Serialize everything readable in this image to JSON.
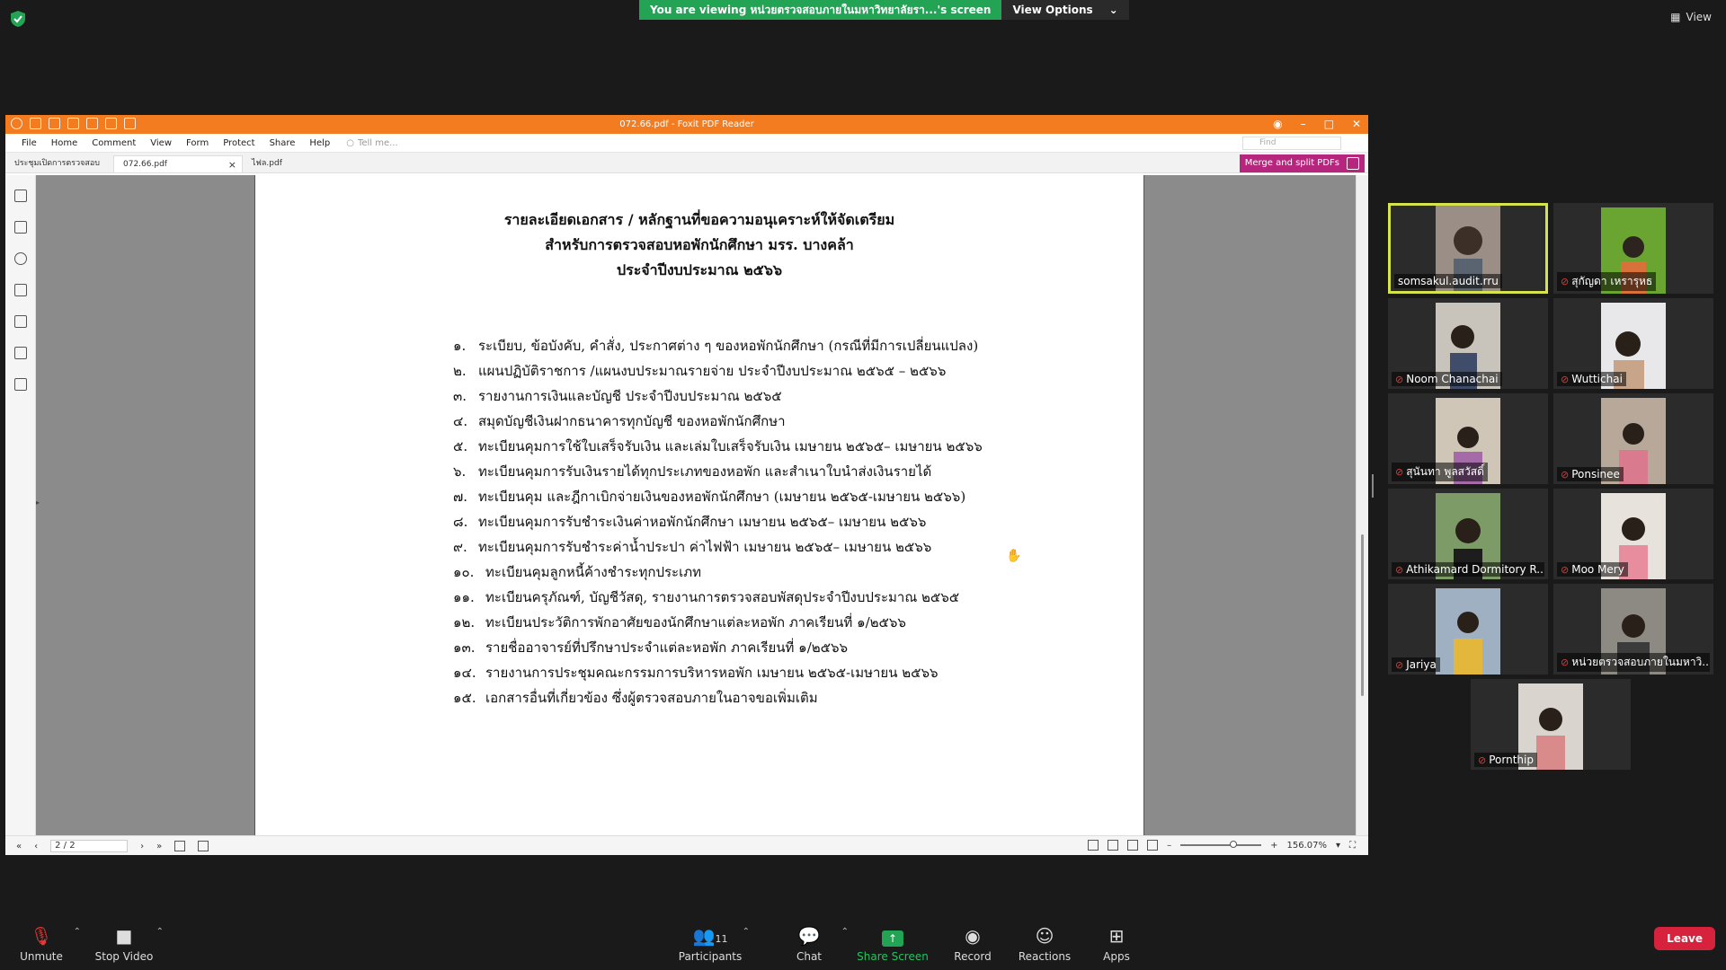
{
  "zoom": {
    "banner_text": "You are viewing หน่วยตรวจสอบภายในมหาวิทยาลัยรา...'s screen",
    "view_options_label": "View Options",
    "view_label": "View",
    "colors": {
      "banner_green": "#23a455",
      "leave_red": "#d6223d",
      "active_speaker": "#d6e34b"
    }
  },
  "foxit": {
    "window_title": "072.66.pdf - Foxit PDF Reader",
    "menu": [
      "File",
      "Home",
      "Comment",
      "View",
      "Form",
      "Protect",
      "Share",
      "Help"
    ],
    "tell_me_placeholder": "Tell me...",
    "find_placeholder": "Find",
    "tabs": [
      {
        "label": "ประชุมเปิดการตรวจสอบ"
      },
      {
        "label": "072.66.pdf"
      },
      {
        "label": "ไฟล.pdf"
      }
    ],
    "merge_label": "Merge and split PDFs",
    "page_indicator": "2 / 2",
    "zoom_level": "156.07%",
    "accent_color": "#f47c20"
  },
  "document": {
    "heading": [
      "รายละเอียดเอกสาร / หลักฐานที่ขอความอนุเคราะห์ให้จัดเตรียม",
      "สำหรับการตรวจสอบหอพักนักศึกษา มรร. บางคล้า",
      "ประจำปีงบประมาณ ๒๕๖๖"
    ],
    "items": [
      {
        "num": "๑.",
        "text": "ระเบียบ, ข้อบังคับ, คำสั่ง, ประกาศต่าง ๆ ของหอพักนักศึกษา (กรณีที่มีการเปลี่ยนแปลง)"
      },
      {
        "num": "๒.",
        "text": "แผนปฏิบัติราชการ /แผนงบประมาณรายจ่าย ประจำปีงบประมาณ ๒๕๖๕ – ๒๕๖๖"
      },
      {
        "num": "๓.",
        "text": "รายงานการเงินและบัญชี ประจำปีงบประมาณ ๒๕๖๕"
      },
      {
        "num": "๔.",
        "text": "สมุดบัญชีเงินฝากธนาคารทุกบัญชี ของหอพักนักศึกษา"
      },
      {
        "num": "๕.",
        "text": "ทะเบียนคุมการใช้ใบเสร็จรับเงิน และเล่มใบเสร็จรับเงิน เมษายน ๒๕๖๕– เมษายน ๒๕๖๖"
      },
      {
        "num": "๖.",
        "text": "ทะเบียนคุมการรับเงินรายได้ทุกประเภทของหอพัก และสำเนาใบนำส่งเงินรายได้"
      },
      {
        "num": "๗.",
        "text": "ทะเบียนคุม และฎีกาเบิกจ่ายเงินของหอพักนักศึกษา (เมษายน ๒๕๖๕-เมษายน ๒๕๖๖)"
      },
      {
        "num": "๘.",
        "text": "ทะเบียนคุมการรับชำระเงินค่าหอพักนักศึกษา เมษายน ๒๕๖๕– เมษายน ๒๕๖๖"
      },
      {
        "num": "๙.",
        "text": "ทะเบียนคุมการรับชำระค่าน้ำประปา ค่าไฟฟ้า เมษายน ๒๕๖๕– เมษายน ๒๕๖๖"
      },
      {
        "num": "๑๐.",
        "text": "ทะเบียนคุมลูกหนี้ค้างชำระทุกประเภท"
      },
      {
        "num": "๑๑.",
        "text": "ทะเบียนครุภัณฑ์, บัญชีวัสดุ, รายงานการตรวจสอบพัสดุประจำปีงบประมาณ ๒๕๖๕"
      },
      {
        "num": "๑๒.",
        "text": "ทะเบียนประวัติการพักอาศัยของนักศึกษาแต่ละหอพัก ภาคเรียนที่ ๑/๒๕๖๖"
      },
      {
        "num": "๑๓.",
        "text": "รายชื่ออาจารย์ที่ปรึกษาประจำแต่ละหอพัก ภาคเรียนที่ ๑/๒๕๖๖"
      },
      {
        "num": "๑๔.",
        "text": "รายงานการประชุมคณะกรรมการบริหารหอพัก เมษายน ๒๕๖๕-เมษายน ๒๕๖๖"
      },
      {
        "num": "๑๕.",
        "text": "เอกสารอื่นที่เกี่ยวข้อง ซึ่งผู้ตรวจสอบภายในอาจขอเพิ่มเติม"
      }
    ]
  },
  "participants_tiles": [
    {
      "name": "somsakul.audit.rru",
      "muted": false,
      "active": true
    },
    {
      "name": "สุกัญดา เหรารุหธ",
      "muted": true,
      "active": false
    },
    {
      "name": "Noom Chanachai",
      "muted": true,
      "active": false
    },
    {
      "name": "Wuttichai",
      "muted": true,
      "active": false
    },
    {
      "name": "สุนันทา พูลสวัสดิ์",
      "muted": true,
      "active": false
    },
    {
      "name": "Ponsinee",
      "muted": true,
      "active": false
    },
    {
      "name": "Athikamard Dormitory R...",
      "muted": true,
      "active": false
    },
    {
      "name": "Moo Mery",
      "muted": true,
      "active": false
    },
    {
      "name": "Jariya",
      "muted": true,
      "active": false
    },
    {
      "name": "หน่วยตรวจสอบภายในมหาวิ...",
      "muted": true,
      "active": false
    },
    {
      "name": "Pornthip",
      "muted": true,
      "active": false
    }
  ],
  "toolbar": {
    "unmute": "Unmute",
    "stop_video": "Stop Video",
    "participants": "Participants",
    "participants_count": "11",
    "chat": "Chat",
    "share_screen": "Share Screen",
    "record": "Record",
    "reactions": "Reactions",
    "apps": "Apps",
    "leave": "Leave"
  }
}
